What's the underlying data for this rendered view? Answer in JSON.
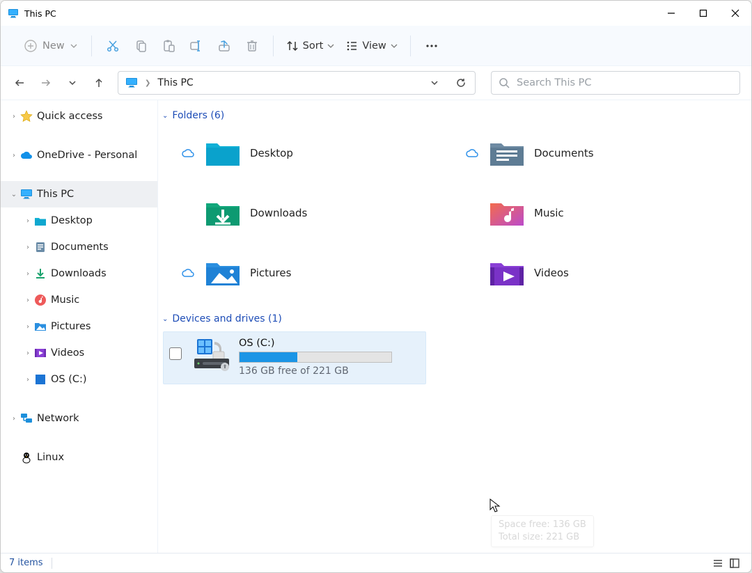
{
  "window": {
    "title": "This PC"
  },
  "toolbar": {
    "new_label": "New",
    "sort_label": "Sort",
    "view_label": "View"
  },
  "addressbar": {
    "location": "This PC"
  },
  "search": {
    "placeholder": "Search This PC"
  },
  "sidebar": {
    "items": [
      {
        "label": "Quick access",
        "indent": 0,
        "expanded": false,
        "icon": "star"
      },
      {
        "label": "OneDrive - Personal",
        "indent": 0,
        "expanded": false,
        "icon": "onedrive"
      },
      {
        "label": "This PC",
        "indent": 0,
        "expanded": true,
        "icon": "pc",
        "selected": true
      },
      {
        "label": "Desktop",
        "indent": 1,
        "expanded": false,
        "icon": "desktop"
      },
      {
        "label": "Documents",
        "indent": 1,
        "expanded": false,
        "icon": "documents"
      },
      {
        "label": "Downloads",
        "indent": 1,
        "expanded": false,
        "icon": "downloads"
      },
      {
        "label": "Music",
        "indent": 1,
        "expanded": false,
        "icon": "music"
      },
      {
        "label": "Pictures",
        "indent": 1,
        "expanded": false,
        "icon": "pictures"
      },
      {
        "label": "Videos",
        "indent": 1,
        "expanded": false,
        "icon": "videos"
      },
      {
        "label": "OS (C:)",
        "indent": 1,
        "expanded": false,
        "icon": "drive"
      },
      {
        "label": "Network",
        "indent": 0,
        "expanded": false,
        "icon": "network"
      },
      {
        "label": "Linux",
        "indent": 0,
        "expanded": null,
        "icon": "linux"
      }
    ]
  },
  "sections": {
    "folders": {
      "title": "Folders (6)"
    },
    "drives": {
      "title": "Devices and drives (1)"
    }
  },
  "folders": [
    {
      "label": "Desktop",
      "cloud": true
    },
    {
      "label": "Documents",
      "cloud": true
    },
    {
      "label": "Downloads",
      "cloud": false
    },
    {
      "label": "Music",
      "cloud": false
    },
    {
      "label": "Pictures",
      "cloud": true
    },
    {
      "label": "Videos",
      "cloud": false
    }
  ],
  "drive": {
    "name": "OS (C:)",
    "free_text": "136 GB free of 221 GB",
    "used_pct": 38,
    "tooltip_line1": "Space free: 136 GB",
    "tooltip_line2": "Total size: 221 GB"
  },
  "statusbar": {
    "items_text": "7 items"
  }
}
